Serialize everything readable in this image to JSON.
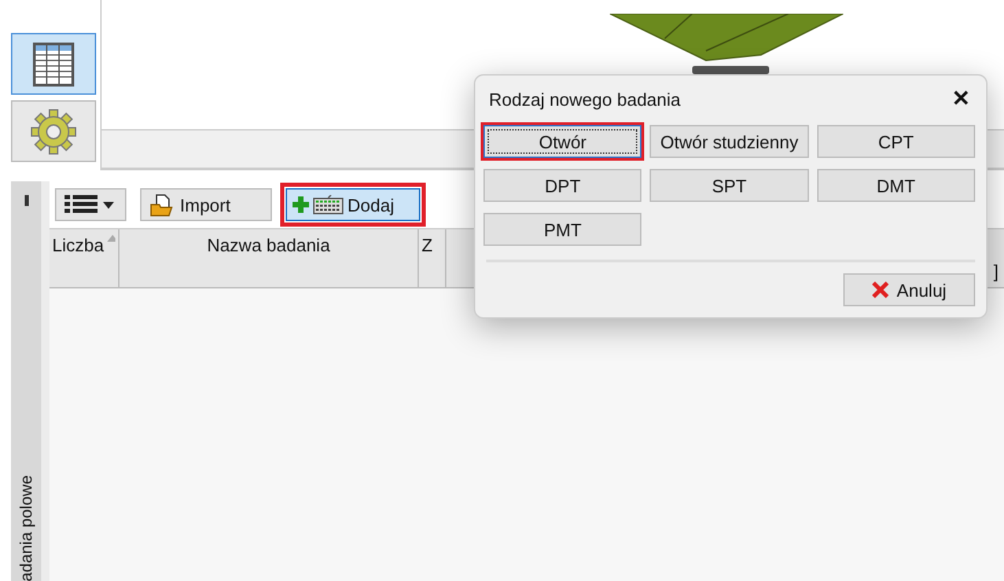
{
  "sidebar": {
    "items": [
      {
        "kind": "table",
        "selected": true
      },
      {
        "kind": "settings",
        "selected": false
      }
    ]
  },
  "panel": {
    "vertical_label": "adania polowe",
    "toolbar": [
      {
        "kind": "menu",
        "highlighted": false
      },
      {
        "kind": "import",
        "label": "Import",
        "highlighted": false
      },
      {
        "kind": "add",
        "label": "Dodaj",
        "highlighted": true
      }
    ],
    "table": {
      "columns": [
        {
          "label": "Liczba",
          "sorted": true
        },
        {
          "label": "Nazwa badania",
          "sorted": false
        },
        {
          "label": "Z",
          "sorted": false
        },
        {
          "label": "]",
          "sorted": false
        }
      ]
    }
  },
  "dialog": {
    "title": "Rodzaj nowego badania",
    "close": "✕",
    "options": [
      {
        "label": "Otwór",
        "focused": true,
        "highlighted": true
      },
      {
        "label": "Otwór studzienny",
        "focused": false,
        "highlighted": false
      },
      {
        "label": "CPT",
        "focused": false,
        "highlighted": false
      },
      {
        "label": "DPT",
        "focused": false,
        "highlighted": false
      },
      {
        "label": "SPT",
        "focused": false,
        "highlighted": false
      },
      {
        "label": "DMT",
        "focused": false,
        "highlighted": false
      },
      {
        "label": "PMT",
        "focused": false,
        "highlighted": false
      }
    ],
    "cancel": "Anuluj"
  }
}
